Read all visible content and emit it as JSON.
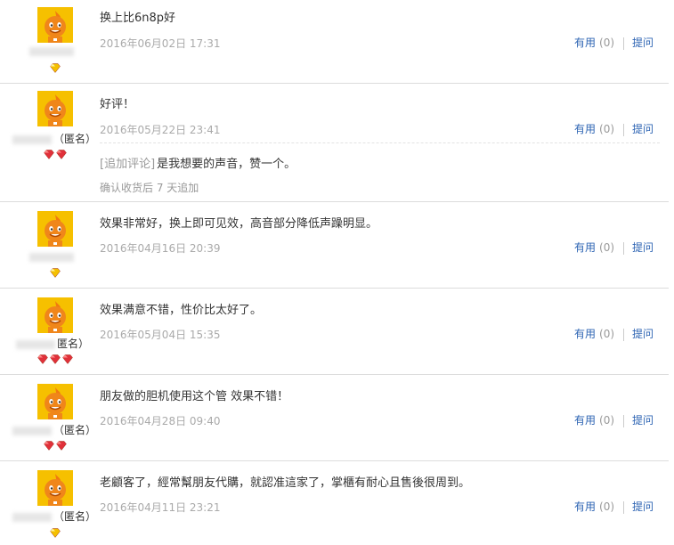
{
  "colors": {
    "link": "#2d64b3",
    "avatar_bg": "#f4b400",
    "diamond_red": "#e0303a",
    "diamond_yellow": "#f4c000"
  },
  "reviews": [
    {
      "content": "换上比6n8p好",
      "date": "2016年06月02日 17:31",
      "user_suffix": "",
      "rank_icons": [
        "yellow-diamond-icon"
      ],
      "useful_label": "有用",
      "useful_count": "(0)",
      "ask_label": "提问"
    },
    {
      "content": "好评！",
      "date": "2016年05月22日 23:41",
      "user_suffix": "（匿名）",
      "rank_icons": [
        "red-diamond-icon",
        "red-diamond-icon"
      ],
      "useful_label": "有用",
      "useful_count": "(0)",
      "ask_label": "提问",
      "append": {
        "tag": "[追加评论]",
        "text": "是我想要的声音，赞一个。",
        "note": "确认收货后 7 天追加"
      }
    },
    {
      "content": "效果非常好，换上即可见效，高音部分降低声躁明显。",
      "date": "2016年04月16日 20:39",
      "user_suffix": "",
      "rank_icons": [
        "yellow-diamond-icon"
      ],
      "useful_label": "有用",
      "useful_count": "(0)",
      "ask_label": "提问"
    },
    {
      "content": "效果满意不错，性价比太好了。",
      "date": "2016年05月04日 15:35",
      "user_suffix": "匿名）",
      "rank_icons": [
        "red-diamond-icon",
        "red-diamond-icon",
        "red-diamond-icon"
      ],
      "useful_label": "有用",
      "useful_count": "(0)",
      "ask_label": "提问"
    },
    {
      "content": "朋友做的胆机使用这个管 效果不错！",
      "date": "2016年04月28日 09:40",
      "user_suffix": "（匿名）",
      "rank_icons": [
        "red-diamond-icon",
        "red-diamond-icon"
      ],
      "useful_label": "有用",
      "useful_count": "(0)",
      "ask_label": "提问"
    },
    {
      "content": "老顧客了，經常幫朋友代購，就認准這家了，掌櫃有耐心且售後很周到。",
      "date": "2016年04月11日 23:21",
      "user_suffix": "（匿名）",
      "rank_icons": [
        "yellow-diamond-icon"
      ],
      "useful_label": "有用",
      "useful_count": "(0)",
      "ask_label": "提问"
    }
  ]
}
